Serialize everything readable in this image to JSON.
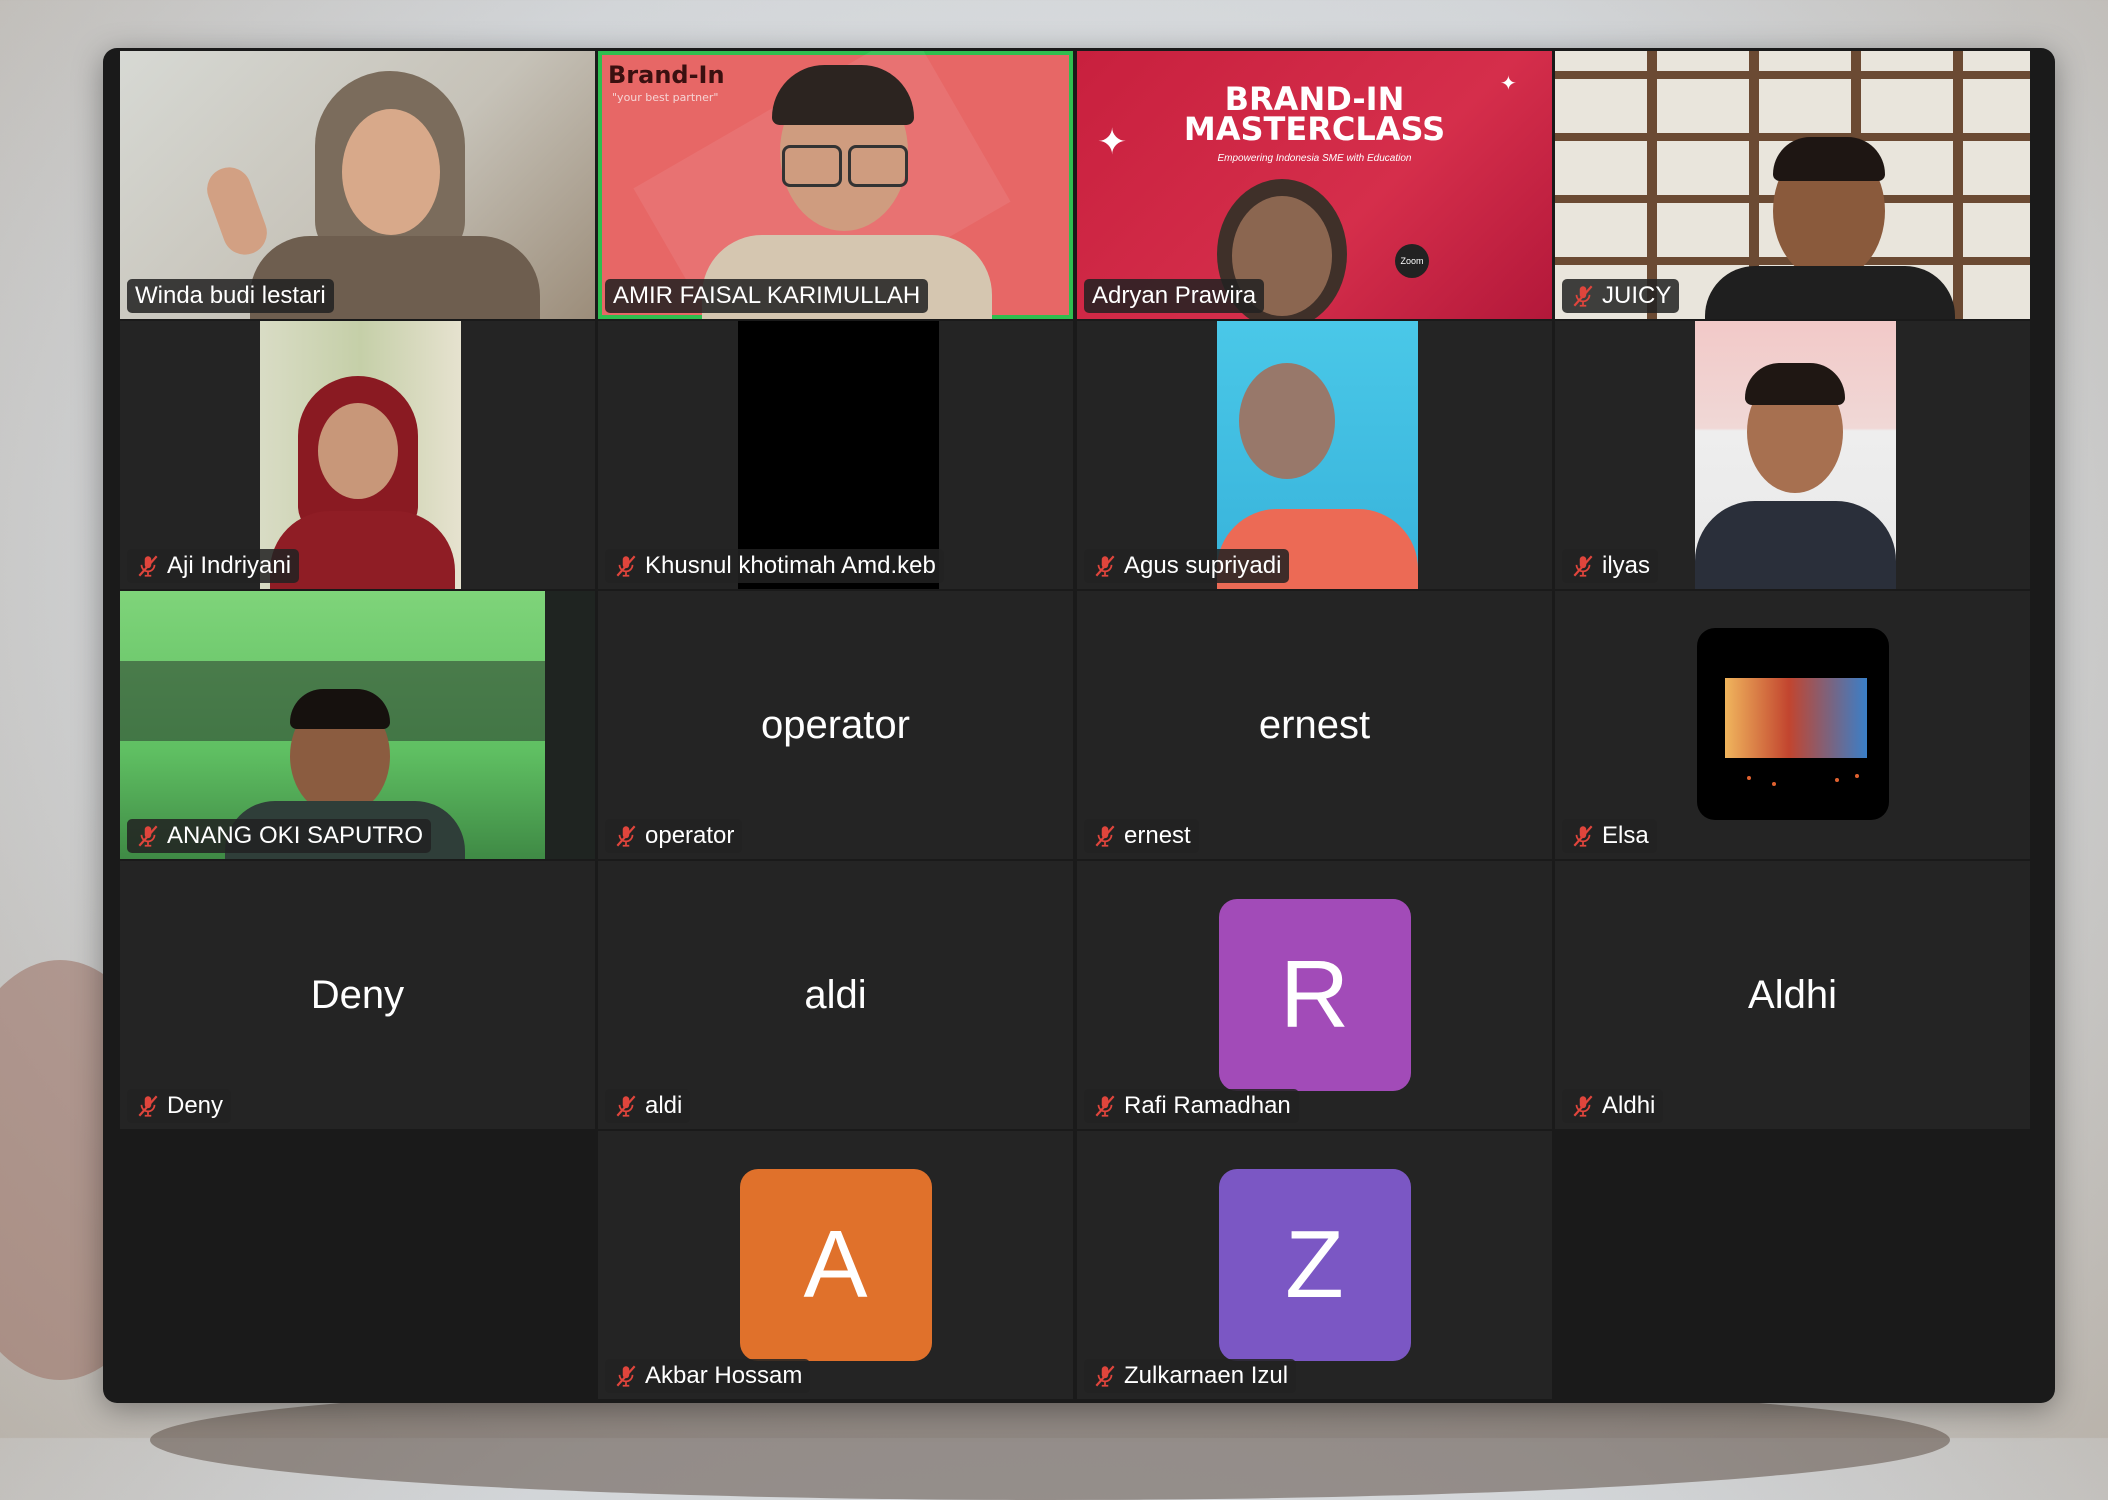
{
  "meeting": {
    "participants": [
      {
        "name": "Winda budi lestari",
        "muted": false
      },
      {
        "name": "AMIR FAISAL KARIMULLAH",
        "muted": false,
        "active_speaker": true
      },
      {
        "name": "Adryan Prawira",
        "muted": false
      },
      {
        "name": "JUICY",
        "muted": true
      },
      {
        "name": "Aji Indriyani",
        "muted": true
      },
      {
        "name": "Khusnul khotimah Amd.keb",
        "muted": true
      },
      {
        "name": "Agus supriyadi",
        "muted": true
      },
      {
        "name": "ilyas",
        "muted": true
      },
      {
        "name": "ANANG OKI SAPUTRO",
        "muted": true
      },
      {
        "name": "operator",
        "muted": true,
        "center_text": "operator"
      },
      {
        "name": "ernest",
        "muted": true,
        "center_text": "ernest"
      },
      {
        "name": "Elsa",
        "muted": true
      },
      {
        "name": "Deny",
        "muted": true,
        "center_text": "Deny"
      },
      {
        "name": "aldi",
        "muted": true,
        "center_text": "aldi"
      },
      {
        "name": "Rafi Ramadhan",
        "muted": true,
        "avatar_letter": "R",
        "avatar_color": "#a24bb8"
      },
      {
        "name": "Aldhi",
        "muted": true,
        "center_text": "Aldhi"
      },
      {
        "name": "Akbar Hossam",
        "muted": true,
        "avatar_letter": "A",
        "avatar_color": "#e0712b"
      },
      {
        "name": "Zulkarnaen Izul",
        "muted": true,
        "avatar_letter": "Z",
        "avatar_color": "#7b57c4"
      }
    ]
  },
  "backgrounds": {
    "brand_in": {
      "title": "Brand-In",
      "tagline": "\"your best partner\""
    },
    "masterclass": {
      "line1": "BRAND-IN",
      "line2": "MASTERCLASS",
      "subtitle": "Empowering Indonesia SME with Education",
      "badge": "Zoom"
    }
  },
  "colors": {
    "window_bg": "#1a1a1a",
    "tile_bg": "#242424",
    "active_speaker_border": "#2fbe4f",
    "mute_icon": "#e0453c"
  }
}
